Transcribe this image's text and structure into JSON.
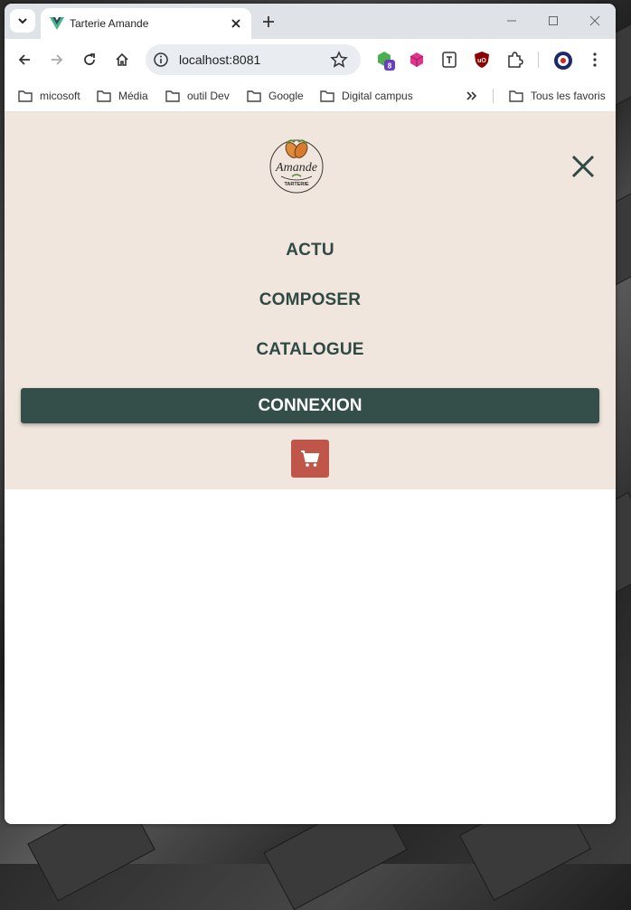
{
  "browser": {
    "tab_title": "Tarterie Amande",
    "address": "localhost:8081",
    "extension_badge": "8"
  },
  "bookmarks": [
    {
      "label": "micosoft"
    },
    {
      "label": "Média"
    },
    {
      "label": "outil Dev"
    },
    {
      "label": "Google"
    },
    {
      "label": "Digital campus"
    }
  ],
  "bookmarks_all": "Tous les favoris",
  "site": {
    "logo_text": "Amande",
    "logo_subtext": "TARTERIE",
    "menu": {
      "actu": "ACTU",
      "composer": "COMPOSER",
      "catalogue": "CATALOGUE",
      "connexion": "CONNEXION"
    },
    "colors": {
      "nav_bg": "#f0e6dd",
      "primary": "#344f4a",
      "cart": "#c0554a"
    }
  },
  "icons": [
    "chevron-down-icon",
    "vue-favicon-icon",
    "close-icon",
    "plus-icon",
    "minimize-icon",
    "maximize-icon",
    "back-icon",
    "forward-icon",
    "reload-icon",
    "home-icon",
    "info-icon",
    "star-icon",
    "extension-icon",
    "puzzle-icon",
    "profile-icon",
    "kebab-menu-icon",
    "folder-icon",
    "double-chevron-icon",
    "cart-icon"
  ]
}
